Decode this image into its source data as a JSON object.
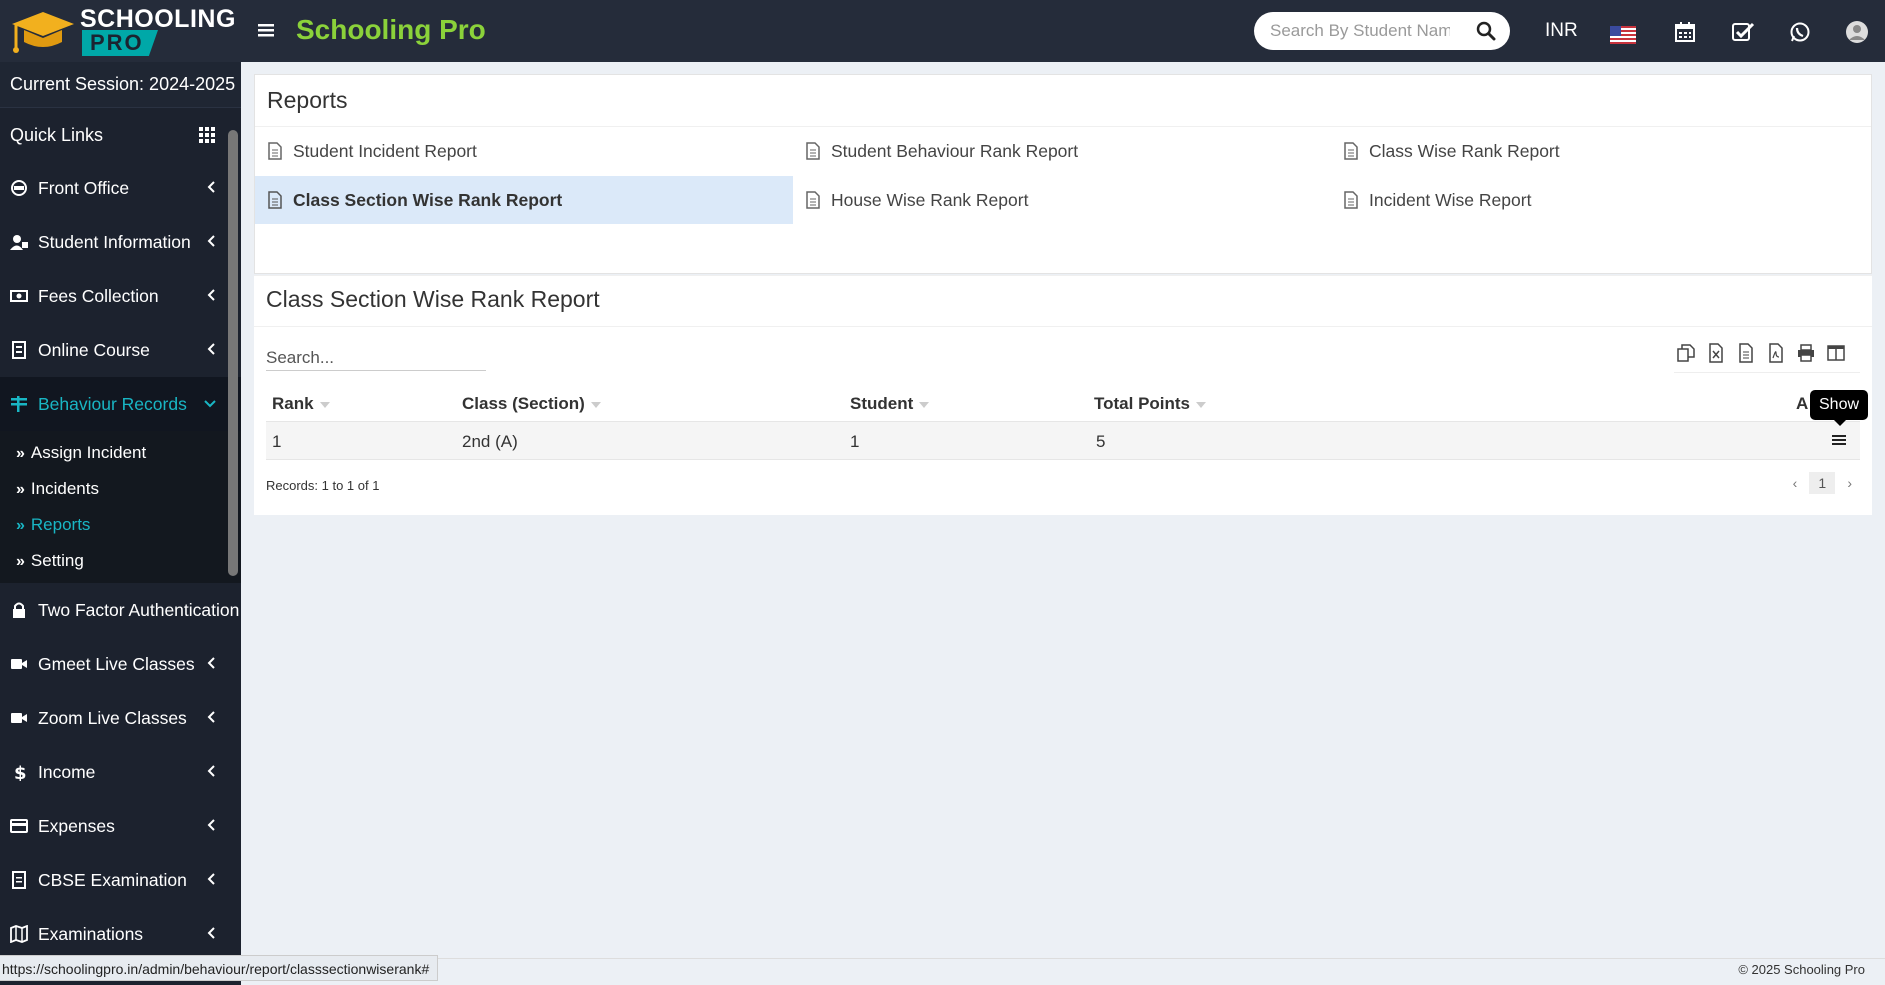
{
  "header": {
    "logo_line1": "SCHOOLING",
    "logo_line2": "PRO",
    "brand": "Schooling Pro",
    "search_placeholder": "Search By Student Name",
    "currency": "INR"
  },
  "sidebar": {
    "session": "Current Session: 2024-2025",
    "quick_links": "Quick Links",
    "items": [
      {
        "label": "Front Office",
        "icon": "front-office-icon"
      },
      {
        "label": "Student Information",
        "icon": "student-icon"
      },
      {
        "label": "Fees Collection",
        "icon": "money-icon"
      },
      {
        "label": "Online Course",
        "icon": "course-icon"
      },
      {
        "label": "Behaviour Records",
        "icon": "behaviour-icon"
      },
      {
        "label": "Two Factor Authentication",
        "icon": "lock-icon"
      },
      {
        "label": "Gmeet Live Classes",
        "icon": "video-icon"
      },
      {
        "label": "Zoom Live Classes",
        "icon": "video-icon"
      },
      {
        "label": "Income",
        "icon": "dollar-icon"
      },
      {
        "label": "Expenses",
        "icon": "card-icon"
      },
      {
        "label": "CBSE Examination",
        "icon": "document-icon"
      },
      {
        "label": "Examinations",
        "icon": "map-icon"
      }
    ],
    "sub_items": [
      {
        "label": "Assign Incident"
      },
      {
        "label": "Incidents"
      },
      {
        "label": "Reports"
      },
      {
        "label": "Setting"
      }
    ]
  },
  "reports": {
    "title": "Reports",
    "links": [
      {
        "label": "Student Incident Report"
      },
      {
        "label": "Student Behaviour Rank Report"
      },
      {
        "label": "Class Wise Rank Report"
      },
      {
        "label": "Class Section Wise Rank Report"
      },
      {
        "label": "House Wise Rank Report"
      },
      {
        "label": "Incident Wise Report"
      }
    ]
  },
  "rank_report": {
    "title": "Class Section Wise Rank Report",
    "search_placeholder": "Search...",
    "columns": [
      "Rank",
      "Class (Section)",
      "Student",
      "Total Points",
      "A"
    ],
    "rows": [
      {
        "rank": "1",
        "class_section": "2nd (A)",
        "student": "1",
        "total_points": "5"
      }
    ],
    "tooltip": "Show",
    "records_info": "Records: 1 to 1 of 1",
    "page": "1",
    "prev": "‹",
    "next": "›"
  },
  "status_url": "https://schoolingpro.in/admin/behaviour/report/classsectionwiserank#",
  "footer": "© 2025 Schooling Pro",
  "colors": {
    "header_bg": "#252c3a",
    "sidebar_bg": "#1c222e",
    "brand_green": "#8bd23a",
    "accent_teal": "#19b6c4",
    "active_link_bg": "#dbe9f9"
  }
}
